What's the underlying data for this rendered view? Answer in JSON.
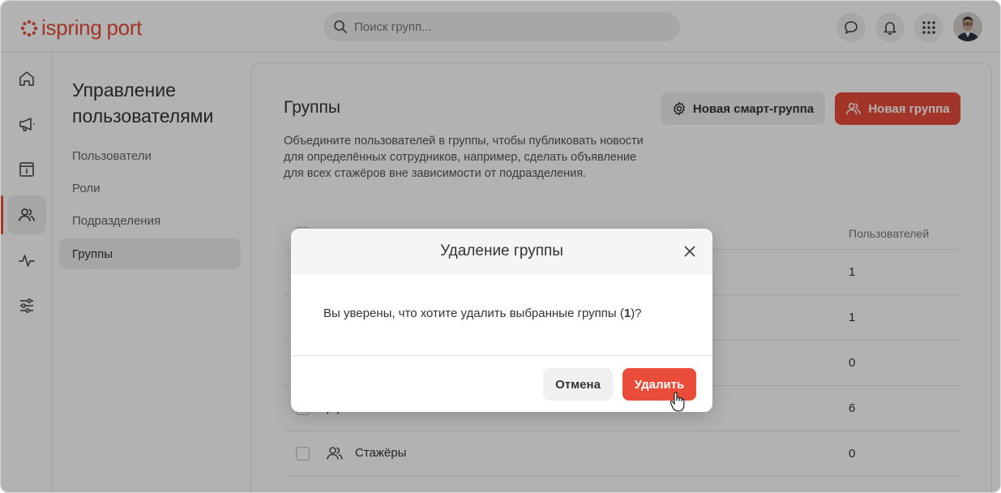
{
  "app": {
    "logo_word1": "ispring",
    "logo_word2": "port"
  },
  "header": {
    "search_placeholder": "Поиск групп..."
  },
  "rail": {
    "items": [
      {
        "icon": "home-icon"
      },
      {
        "icon": "megaphone-icon"
      },
      {
        "icon": "info-book-icon"
      },
      {
        "icon": "users-icon",
        "active": true
      },
      {
        "icon": "activity-icon"
      },
      {
        "icon": "sliders-icon"
      }
    ]
  },
  "subnav": {
    "title": "Управление пользователями",
    "items": [
      {
        "label": "Пользователи"
      },
      {
        "label": "Роли"
      },
      {
        "label": "Подразделения"
      },
      {
        "label": "Группы",
        "active": true
      }
    ]
  },
  "main": {
    "title": "Группы",
    "smart_group_button": "Новая смарт-группа",
    "new_group_button": "Новая группа",
    "description": "Объедините пользователей в группы, чтобы публиковать новости для определённых сотрудников, например, сделать объявление для всех стажёров вне зависимости от подразделения.",
    "table": {
      "count_header": "Пользователей",
      "rows": [
        {
          "name": "",
          "count": "1"
        },
        {
          "name": "",
          "count": "1"
        },
        {
          "name": "",
          "count": "0"
        },
        {
          "name": "",
          "count": "6"
        },
        {
          "name": "Стажёры",
          "count": "0"
        }
      ]
    }
  },
  "modal": {
    "title": "Удаление группы",
    "message_prefix": "Вы уверены, что хотите удалить выбранные группы (",
    "message_count": "1",
    "message_suffix": ")?",
    "cancel_label": "Отмена",
    "delete_label": "Удалить"
  },
  "colors": {
    "accent": "#e94d39"
  }
}
